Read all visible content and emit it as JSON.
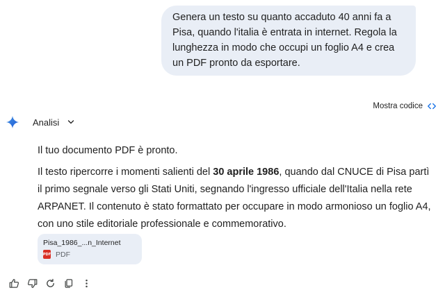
{
  "user_message": {
    "text": "Genera un testo su quanto accaduto 40 anni fa a Pisa, quando l'italia è entrata in internet. Regola la lunghezza in modo che occupi un foglio A4 e crea un PDF pronto da esportare."
  },
  "show_code": {
    "label": "Mostra codice"
  },
  "assistant": {
    "analysis_label": "Analisi",
    "paragraph1": "Il tuo documento PDF è pronto.",
    "paragraph2_before": "Il testo ripercorre i momenti salienti del ",
    "paragraph2_bold": "30 aprile 1986",
    "paragraph2_after": ", quando dal CNUCE di Pisa partì il primo segnale verso gli Stati Uniti, segnando l'ingresso ufficiale dell'Italia nella rete ARPANET. Il contenuto è stato formattato per occupare in modo armonioso un foglio A4, con uno stile editoriale professionale e commemorativo."
  },
  "attachment": {
    "file_name": "Pisa_1986_...n_Internet",
    "icon_label": "PDF",
    "file_type": "PDF"
  },
  "actions": {
    "icons": [
      "thumbs-up-icon",
      "thumbs-down-icon",
      "regenerate-icon",
      "copy-icon",
      "more-options-icon"
    ]
  },
  "colors": {
    "user_bubble": "#e9eef6",
    "accent_blue": "#1a73e8",
    "pdf_red": "#d93025"
  }
}
